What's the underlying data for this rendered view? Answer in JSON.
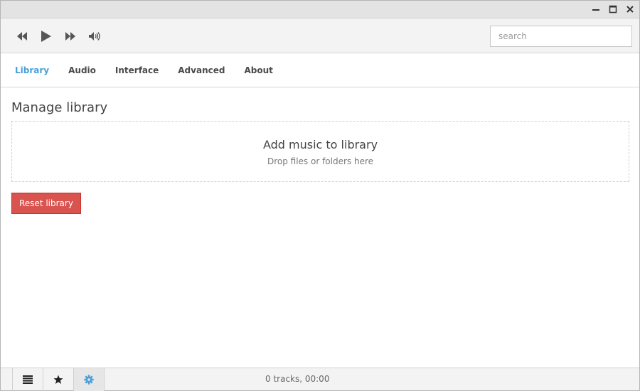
{
  "window": {
    "controls": [
      {
        "name": "minimize",
        "icon": "minimize-icon"
      },
      {
        "name": "maximize",
        "icon": "maximize-icon"
      },
      {
        "name": "close",
        "icon": "close-icon"
      }
    ]
  },
  "toolbar": {
    "player_controls": [
      {
        "name": "previous",
        "icon": "rewind-icon"
      },
      {
        "name": "play",
        "icon": "play-icon"
      },
      {
        "name": "next",
        "icon": "fast-forward-icon"
      },
      {
        "name": "volume",
        "icon": "volume-icon"
      }
    ],
    "search": {
      "value": "",
      "placeholder": "search"
    }
  },
  "tabs": [
    {
      "label": "Library",
      "active": true
    },
    {
      "label": "Audio",
      "active": false
    },
    {
      "label": "Interface",
      "active": false
    },
    {
      "label": "Advanced",
      "active": false
    },
    {
      "label": "About",
      "active": false
    }
  ],
  "content": {
    "heading": "Manage library",
    "dropzone": {
      "title": "Add music to library",
      "subtitle": "Drop files or folders here"
    },
    "reset_button": "Reset library"
  },
  "statusbar": {
    "buttons": [
      {
        "name": "playlist",
        "icon": "list-icon",
        "active": false
      },
      {
        "name": "favorites",
        "icon": "star-icon",
        "active": false
      },
      {
        "name": "settings",
        "icon": "gear-icon",
        "active": true
      }
    ],
    "status_text": "0 tracks, 00:00"
  },
  "colors": {
    "accent": "#4aa0d8",
    "danger": "#d9534f"
  }
}
